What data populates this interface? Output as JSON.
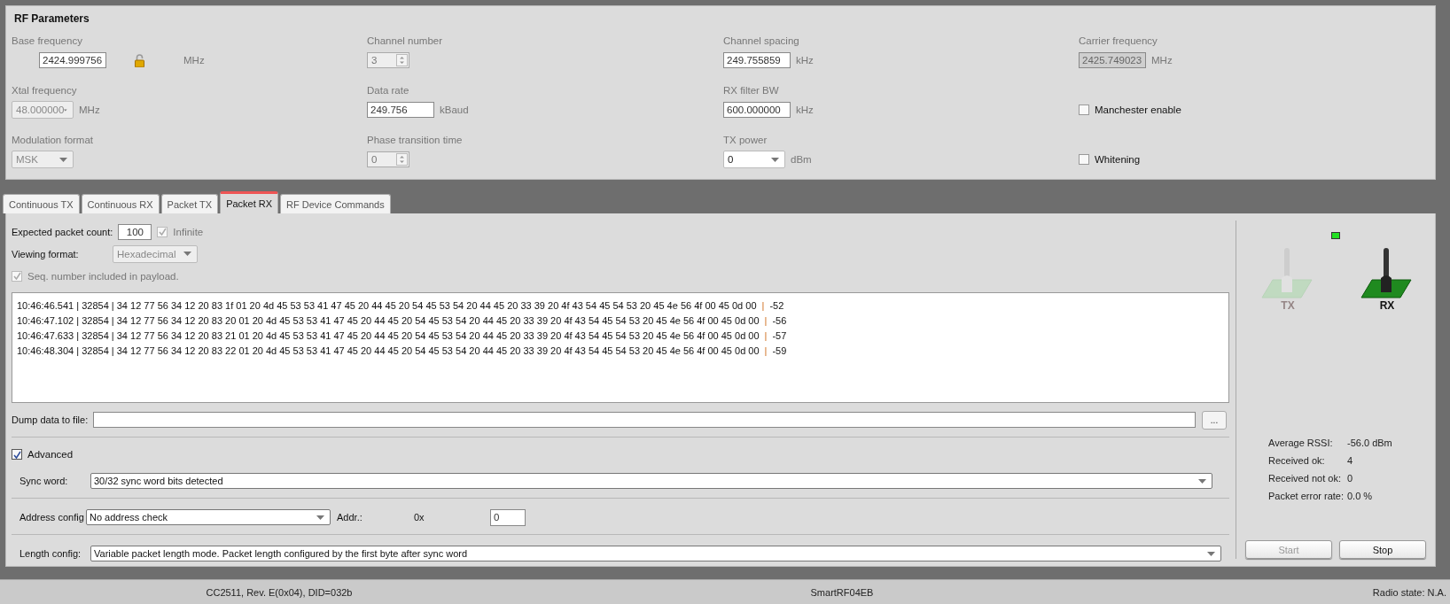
{
  "rf_parameters": {
    "title": "RF Parameters",
    "params": [
      {
        "label": "Base frequency",
        "kind": "text",
        "value": "2424.999756",
        "unit": "MHz",
        "locked": true
      },
      {
        "label": "Channel number",
        "kind": "spin",
        "value": "3",
        "disabled": true
      },
      {
        "label": "Channel spacing",
        "kind": "text",
        "value": "249.755859",
        "unit": "kHz"
      },
      {
        "label": "Carrier frequency",
        "kind": "readonly",
        "value": "2425.749023",
        "unit": "MHz"
      },
      {
        "label": "Xtal frequency",
        "kind": "combo",
        "value": "48.000000",
        "unit": "MHz",
        "disabled": true
      },
      {
        "label": "Data rate",
        "kind": "text",
        "value": "249.756",
        "unit": "kBaud"
      },
      {
        "label": "RX filter BW",
        "kind": "text",
        "value": "600.000000",
        "unit": "kHz"
      },
      {
        "kind": "check",
        "text": "Manchester enable",
        "checked": false
      },
      {
        "label": "Modulation format",
        "kind": "combo",
        "value": "MSK",
        "disabled": true
      },
      {
        "label": "Phase transition time",
        "kind": "spin",
        "value": "0",
        "disabled": true
      },
      {
        "label": "TX power",
        "kind": "combo",
        "value": "0",
        "unit": "dBm",
        "disabled": false
      },
      {
        "kind": "check",
        "text": "Whitening",
        "checked": false
      }
    ]
  },
  "tabs": [
    {
      "label": "Continuous TX",
      "selected": false
    },
    {
      "label": "Continuous RX",
      "selected": false
    },
    {
      "label": "Packet TX",
      "selected": false
    },
    {
      "label": "Packet RX",
      "selected": true
    },
    {
      "label": "RF Device Commands",
      "selected": false
    }
  ],
  "packet_rx": {
    "expected_count": {
      "label": "Expected packet count:",
      "value": "100"
    },
    "infinite": {
      "text": "Infinite",
      "checked": true
    },
    "viewing_format": {
      "label": "Viewing format:",
      "value": "Hexadecimal"
    },
    "seq_in_payload": {
      "text": "Seq. number included in payload.",
      "checked": true
    },
    "log": [
      {
        "data": "10:46:46.541 | 32854 | 34 12 77 56 34 12 20 83 1f 01 20 4d 45 53 53 41 47 45 20 44 45 20 54 45 53 54 20 44 45 20 33 39 20 4f 43 54 45 54 53 20 45 4e 56 4f 00 45 0d 00",
        "separator": "|",
        "rssi": "-52"
      },
      {
        "data": "10:46:47.102 | 32854 | 34 12 77 56 34 12 20 83 20 01 20 4d 45 53 53 41 47 45 20 44 45 20 54 45 53 54 20 44 45 20 33 39 20 4f 43 54 45 54 53 20 45 4e 56 4f 00 45 0d 00",
        "separator": "|",
        "rssi": "-56"
      },
      {
        "data": "10:46:47.633 | 32854 | 34 12 77 56 34 12 20 83 21 01 20 4d 45 53 53 41 47 45 20 44 45 20 54 45 53 54 20 44 45 20 33 39 20 4f 43 54 45 54 53 20 45 4e 56 4f 00 45 0d 00",
        "separator": "|",
        "rssi": "-57"
      },
      {
        "data": "10:46:48.304 | 32854 | 34 12 77 56 34 12 20 83 22 01 20 4d 45 53 53 41 47 45 20 44 45 20 54 45 53 54 20 44 45 20 33 39 20 4f 43 54 45 54 53 20 45 4e 56 4f 00 45 0d 00",
        "separator": "|",
        "rssi": "-59"
      }
    ],
    "dump": {
      "label": "Dump data to file:",
      "browse": "..."
    },
    "advanced": {
      "text": "Advanced",
      "checked": true
    },
    "sync_word": {
      "label": "Sync word:",
      "value": "30/32 sync word bits detected"
    },
    "address_config": {
      "label": "Address config",
      "value": "No address check",
      "addr_label": "Addr.:",
      "prefix": "0x",
      "addr_value": "0"
    },
    "length_config": {
      "label": "Length config:",
      "value": "Variable packet length mode. Packet length configured by the first byte after sync word"
    }
  },
  "side": {
    "indicator": {
      "on": true
    },
    "modes": [
      {
        "label": "TX",
        "active": false
      },
      {
        "label": "RX",
        "active": true
      }
    ],
    "stats": [
      {
        "label": "Average RSSI:",
        "value": "-56.0 dBm"
      },
      {
        "label": "Received ok:",
        "value": "4"
      },
      {
        "label": "Received not ok:",
        "value": "0"
      },
      {
        "label": "Packet error rate:",
        "value": "0.0 %"
      }
    ],
    "buttons": [
      {
        "label": "Start",
        "disabled": true
      },
      {
        "label": "Stop",
        "disabled": false
      }
    ]
  },
  "status_bar": [
    "CC2511, Rev. E(0x04), DID=032b",
    "SmartRF04EB",
    "Radio state: N.A."
  ]
}
